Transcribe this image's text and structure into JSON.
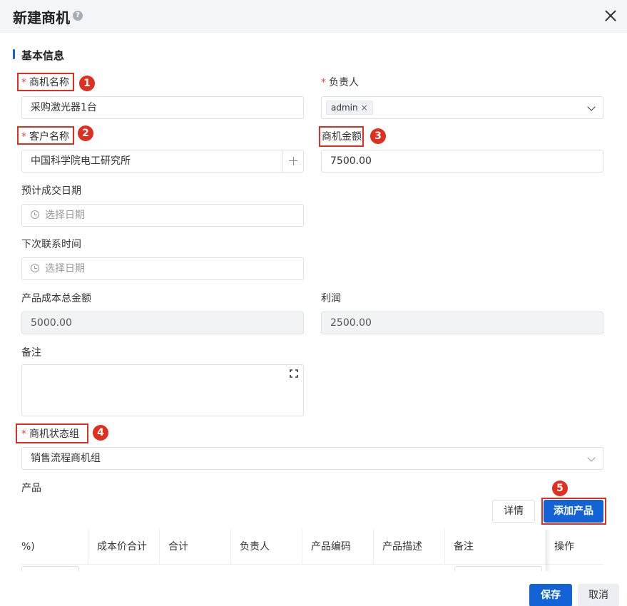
{
  "dialog": {
    "title": "新建商机",
    "help": "?",
    "close": "×"
  },
  "section": {
    "title": "基本信息"
  },
  "form": {
    "required_mark": "*",
    "name": {
      "label": "商机名称",
      "value": "采购激光器1台"
    },
    "owner": {
      "label": "负责人",
      "tag": "admin",
      "tag_close": "×"
    },
    "customer": {
      "label": "客户名称",
      "value": "中国科学院电工研究所"
    },
    "amount": {
      "label": "商机金额",
      "value": "7500.00"
    },
    "deal_date": {
      "label": "预计成交日期",
      "placeholder": "选择日期"
    },
    "next_contact": {
      "label": "下次联系时间",
      "placeholder": "选择日期"
    },
    "cost_total": {
      "label": "产品成本总金额",
      "value": "5000.00"
    },
    "profit": {
      "label": "利润",
      "value": "2500.00"
    },
    "remark": {
      "label": "备注",
      "value": ""
    },
    "status_group": {
      "label": "商机状态组",
      "value": "销售流程商机组"
    },
    "product": {
      "label": "产品"
    }
  },
  "annotations": [
    "1",
    "2",
    "3",
    "4",
    "5"
  ],
  "product_actions": {
    "detail": "详情",
    "add": "添加产品"
  },
  "table": {
    "columns": [
      "%)",
      "成本价合计",
      "合计",
      "负责人",
      "产品编码",
      "产品描述",
      "备注",
      "操作"
    ]
  },
  "footer": {
    "save": "保存",
    "cancel": "取消"
  },
  "colors": {
    "primary": "#1463d6",
    "annotation": "#e02e1f",
    "required": "#e5483b"
  }
}
